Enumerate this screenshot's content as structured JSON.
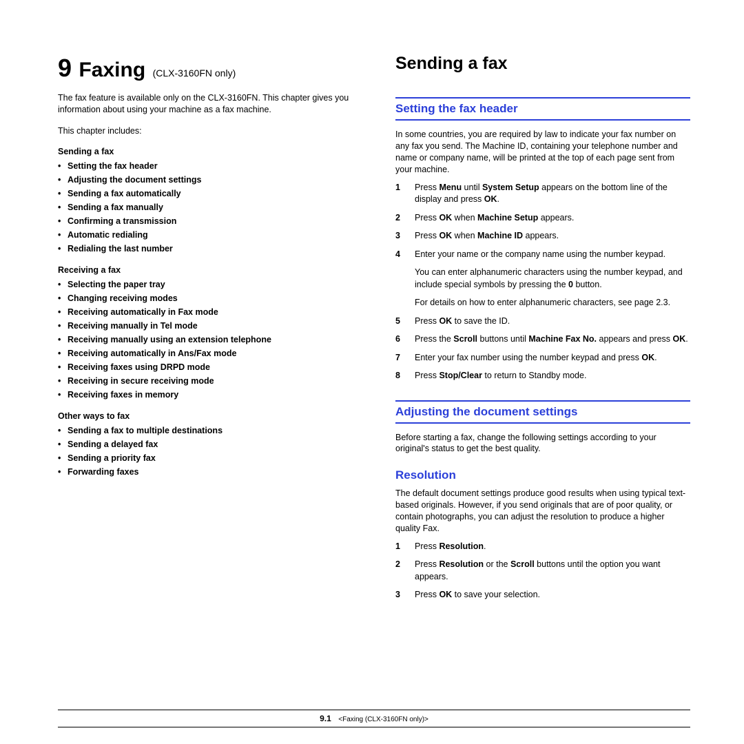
{
  "chapter": {
    "number": "9",
    "title": "Faxing",
    "subtitle": "(CLX-3160FN only)",
    "intro": "The fax feature is available only on the CLX-3160FN. This chapter gives you information about using your machine as a fax machine.",
    "includes": "This chapter includes:"
  },
  "toc": {
    "g1": {
      "title": "Sending a fax",
      "items": [
        "Setting the fax header",
        "Adjusting the document settings",
        "Sending a fax automatically",
        "Sending a fax manually",
        "Confirming a transmission",
        "Automatic redialing",
        "Redialing the last number"
      ]
    },
    "g2": {
      "title": "Receiving a fax",
      "items": [
        "Selecting the paper tray",
        "Changing receiving modes",
        "Receiving automatically in Fax mode",
        "Receiving manually in Tel mode",
        "Receiving manually using an extension telephone",
        "Receiving automatically in Ans/Fax mode",
        "Receiving faxes using DRPD mode",
        "Receiving in secure receiving mode",
        "Receiving faxes in memory"
      ]
    },
    "g3": {
      "title": "Other ways to fax",
      "items": [
        "Sending a fax to multiple destinations",
        "Sending a delayed fax",
        "Sending a priority fax",
        "Forwarding faxes"
      ]
    }
  },
  "right": {
    "h1": "Sending a fax",
    "s1": {
      "title": "Setting the fax header",
      "intro": "In some countries, you are required by law to indicate your fax number on any fax you send. The Machine ID, containing your telephone number and name or company name, will be printed at the top of each page sent from your machine.",
      "steps": {
        "1a": "Press ",
        "1b": "Menu",
        "1c": " until ",
        "1d": "System Setup",
        "1e": " appears on the bottom line of the display and press ",
        "1f": "OK",
        "1g": ".",
        "2a": "Press ",
        "2b": "OK",
        "2c": " when ",
        "2d": "Machine Setup",
        "2e": " appears.",
        "3a": "Press ",
        "3b": "OK",
        "3c": " when ",
        "3d": "Machine ID",
        "3e": " appears.",
        "4a": "Enter your name or the company name using the number keypad.",
        "4sub1a": "You can enter alphanumeric characters using the number keypad, and include special symbols by pressing the ",
        "4sub1b": "0",
        "4sub1c": " button.",
        "4sub2": "For details on how to enter alphanumeric characters, see page 2.3.",
        "5a": "Press ",
        "5b": "OK",
        "5c": " to save the ID.",
        "6a": "Press the ",
        "6b": "Scroll",
        "6c": " buttons until ",
        "6d": "Machine Fax No.",
        "6e": " appears and press ",
        "6f": "OK",
        "6g": ".",
        "7a": "Enter your fax number using the number keypad and press ",
        "7b": "OK",
        "7c": ".",
        "8a": "Press ",
        "8b": "Stop/Clear",
        "8c": " to return to Standby mode."
      }
    },
    "s2": {
      "title": "Adjusting the document settings",
      "intro": "Before starting a fax, change the following settings according to your original's status to get the best quality.",
      "sub": {
        "title": "Resolution",
        "intro": "The default document settings produce good results when using typical text-based originals. However, if you send originals that are of poor quality, or contain photographs, you can adjust the resolution to produce a higher quality Fax.",
        "steps": {
          "1a": "Press ",
          "1b": "Resolution",
          "1c": ".",
          "2a": "Press ",
          "2b": "Resolution",
          "2c": " or the ",
          "2d": "Scroll",
          "2e": " buttons until the option you want appears.",
          "3a": "Press ",
          "3b": "OK",
          "3c": " to save your selection."
        }
      }
    }
  },
  "footer": {
    "page": "9.1",
    "label": "<Faxing (CLX-3160FN only)>"
  }
}
